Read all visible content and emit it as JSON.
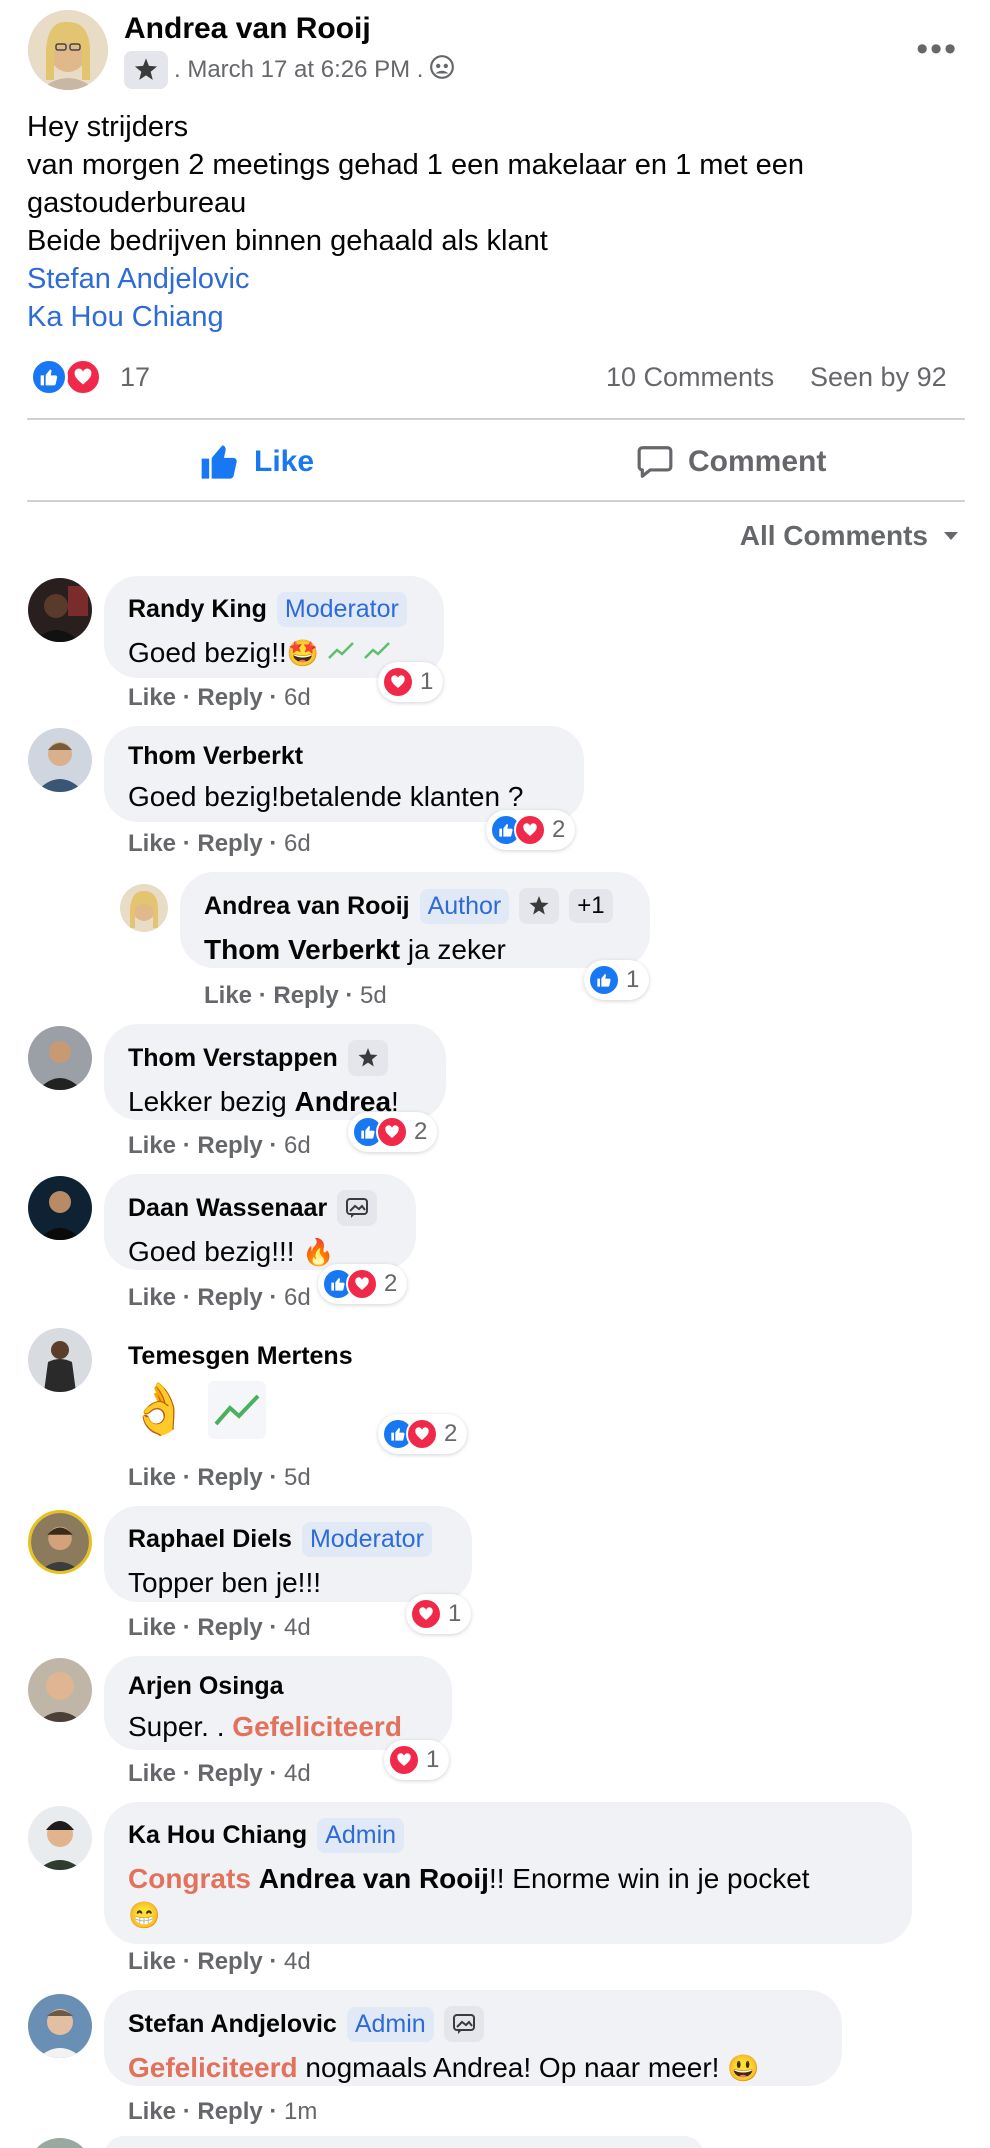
{
  "post": {
    "author": "Andrea van Rooij",
    "timestamp": ". March 17 at 6:26 PM .",
    "lines": [
      "Hey strijders",
      "van morgen 2 meetings gehad 1 een makelaar en 1 met een gastouderbureau",
      "Beide bedrijven binnen gehaald als klant"
    ],
    "mentions": [
      "Stefan Andjelovic",
      "Ka Hou Chiang"
    ],
    "reaction_count": "17",
    "comments_count": "10 Comments",
    "seen_by": "Seen by 92"
  },
  "actions": {
    "like": "Like",
    "comment": "Comment"
  },
  "sort": {
    "label": "All Comments"
  },
  "comment_actions": {
    "like": "Like",
    "reply": "Reply"
  },
  "comments": [
    {
      "name": "Randy King",
      "role": "Moderator",
      "text": "Goed bezig!!",
      "time": "6d",
      "reactions": "1"
    },
    {
      "name": "Thom Verberkt",
      "text": "Goed bezig!betalende klanten ?",
      "time": "6d",
      "reactions": "2"
    },
    {
      "name": "Andrea van Rooij",
      "role": "Author",
      "extra": "+1",
      "mention": "Thom Verberkt",
      "text": " ja zeker",
      "time": "5d",
      "reactions": "1"
    },
    {
      "name": "Thom Verstappen",
      "text_pre": "Lekker bezig ",
      "mention": "Andrea",
      "text_post": "!",
      "time": "6d",
      "reactions": "2"
    },
    {
      "name": "Daan Wassenaar",
      "text": "Goed bezig!!! ",
      "time": "6d",
      "reactions": "2"
    },
    {
      "name": "Temesgen Mertens",
      "time": "5d",
      "reactions": "2"
    },
    {
      "name": "Raphael Diels",
      "role": "Moderator",
      "text": "Topper ben je!!!",
      "time": "4d",
      "reactions": "1"
    },
    {
      "name": "Arjen Osinga",
      "text_pre": "Super. . ",
      "highlight": "Gefeliciteerd",
      "time": "4d",
      "reactions": "1"
    },
    {
      "name": "Ka Hou Chiang",
      "role": "Admin",
      "highlight": "Congrats",
      "mention": "Andrea van Rooij",
      "text_post": "!! Enorme win in je pocket",
      "time": "4d"
    },
    {
      "name": "Stefan Andjelovic",
      "role": "Admin",
      "highlight": "Gefeliciteerd",
      "text_post": " nogmaals Andrea! Op naar meer! ",
      "time": "1m"
    }
  ],
  "colors": {
    "accent": "#1877f2",
    "love": "#f02849",
    "mention": "#2d6bd6",
    "highlight": "#e2725b",
    "bubble": "#f0f2f5"
  }
}
